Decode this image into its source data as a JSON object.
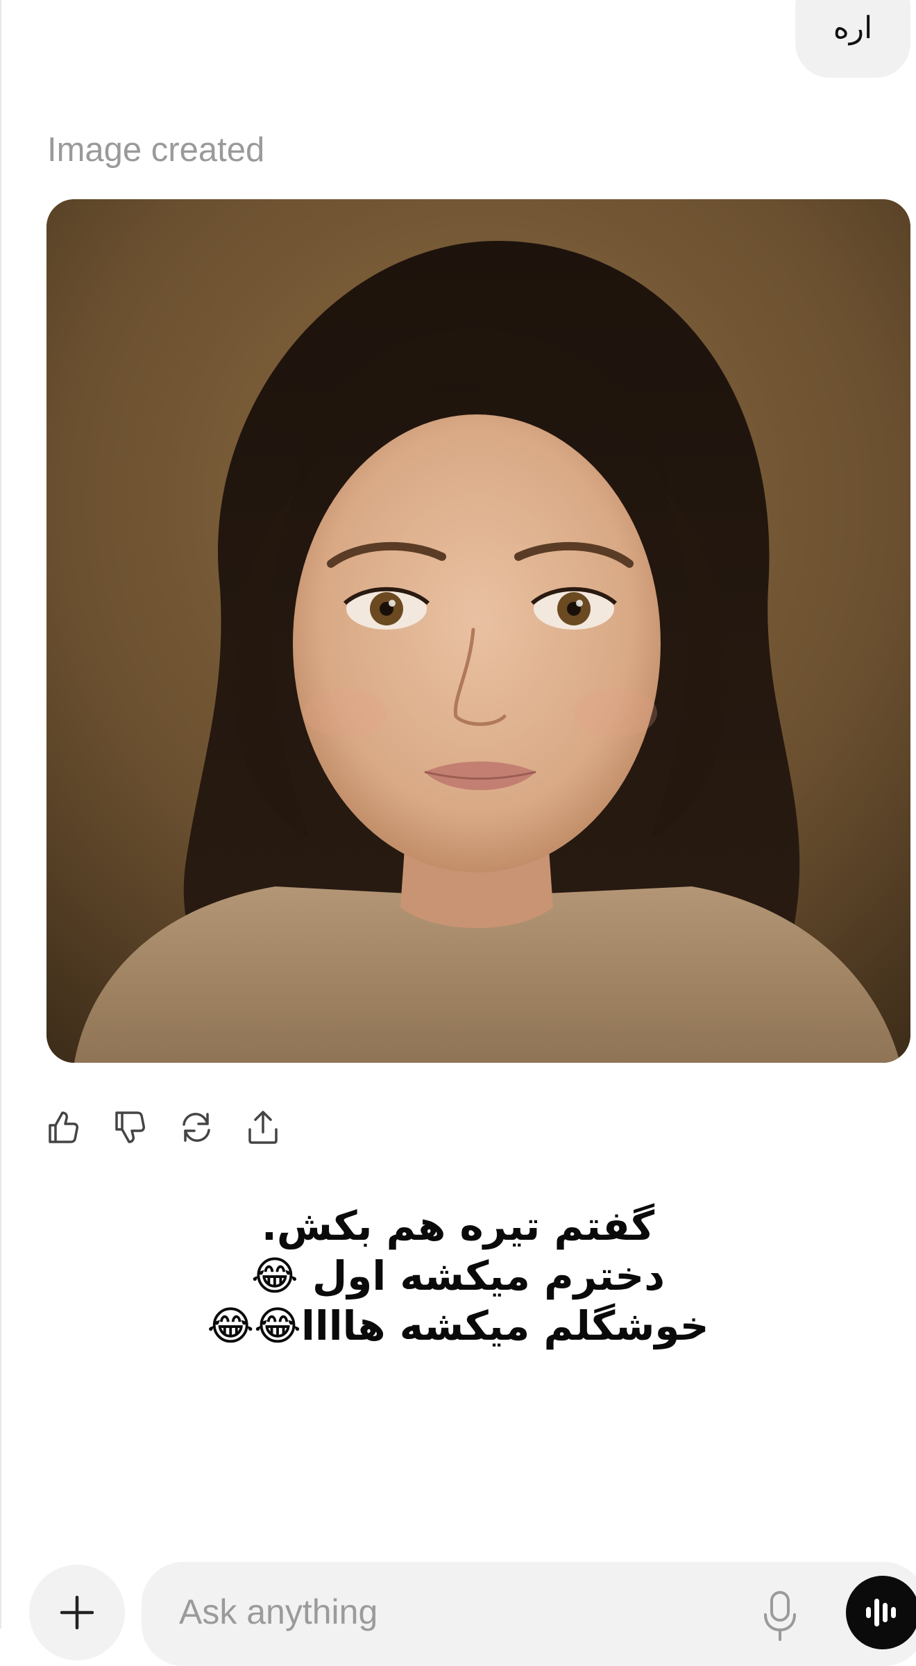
{
  "chat": {
    "user_message": "اره",
    "assistant_status": "Image created",
    "generated_image": {
      "alt": "Generated portrait image",
      "background_color": "#6e5433"
    },
    "actions": [
      {
        "name": "thumbs-up-button",
        "icon": "thumbs-up-icon"
      },
      {
        "name": "thumbs-down-button",
        "icon": "thumbs-down-icon"
      },
      {
        "name": "regenerate-button",
        "icon": "refresh-icon"
      },
      {
        "name": "share-button",
        "icon": "share-icon"
      }
    ]
  },
  "caption": {
    "lines": [
      "گفتم تیره هم بکش.",
      "دخترم میکشه اول 😂",
      "خوشگلم میکشه هاااا😂😂"
    ]
  },
  "composer": {
    "placeholder": "Ask anything",
    "plus_icon": "plus-icon",
    "mic_icon": "microphone-icon",
    "voice_icon": "voice-mode-icon"
  },
  "colors": {
    "bubble": "#f1f1f1",
    "muted_text": "#9a9a9a",
    "voice_button": "#0b0b0b"
  }
}
